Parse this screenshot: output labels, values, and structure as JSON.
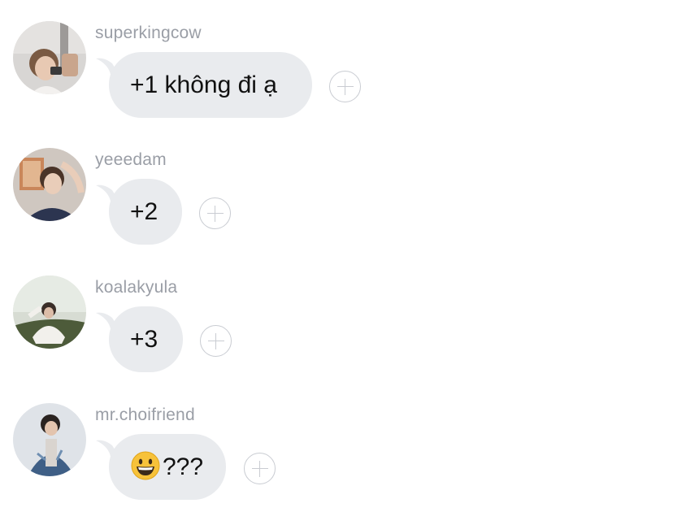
{
  "messages": [
    {
      "username": "superkingcow",
      "text": "+1 không đi ạ",
      "emoji": ""
    },
    {
      "username": "yeeedam",
      "text": "+2",
      "emoji": ""
    },
    {
      "username": "koalakyula",
      "text": "+3",
      "emoji": ""
    },
    {
      "username": "mr.choifriend",
      "text": "???",
      "emoji": "grinning-face-emoji"
    }
  ],
  "colors": {
    "bubble": "#e9ebee",
    "username": "#9a9ea6",
    "react_icon": "#c9ccd2"
  },
  "icons": {
    "reaction": "add-reaction-icon"
  }
}
